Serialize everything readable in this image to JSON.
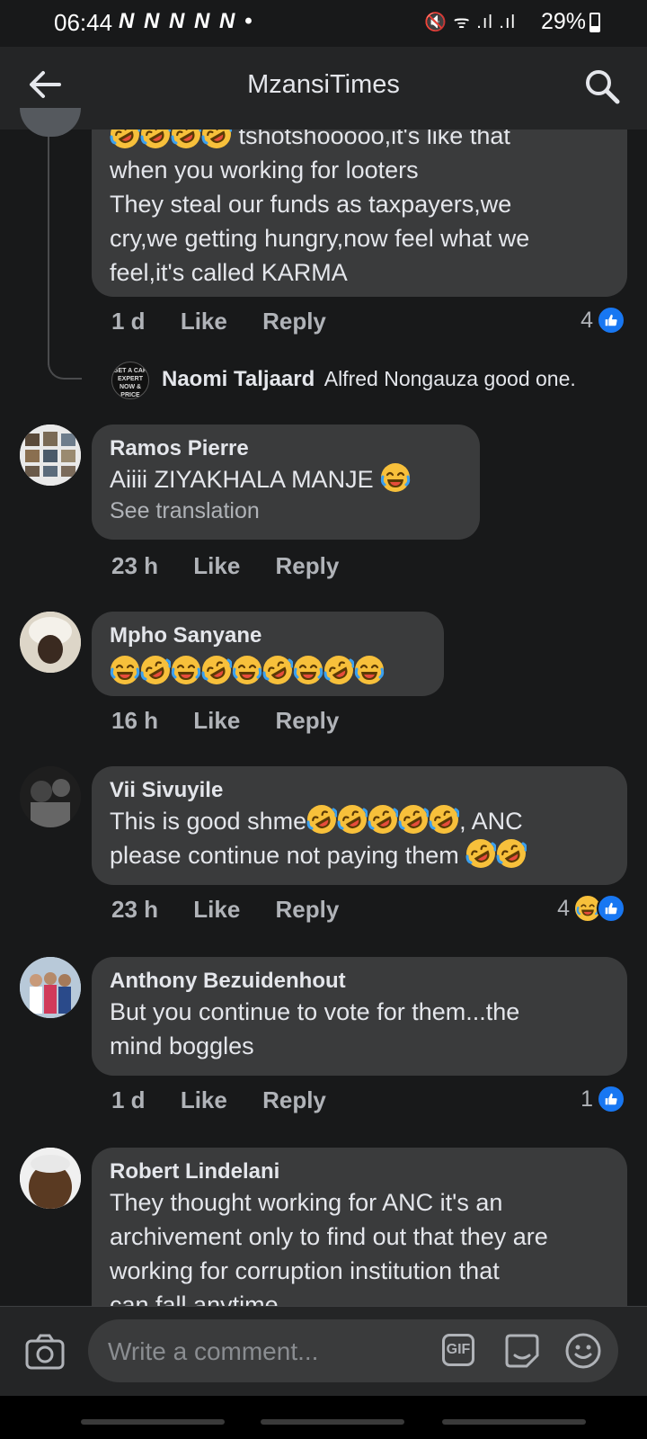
{
  "status_bar": {
    "time": "06:44",
    "notifications": "N N N N N •",
    "signal_icons": "🔇 ᯤ .ıl .ıl",
    "battery": "29%"
  },
  "header": {
    "title": "MzansiTimes"
  },
  "comments": [
    {
      "partial_text": "🤣🤣🤣🤣 tshotshooooo,it's like that when you working for looters They steal our funds as taxpayers,we cry,we getting hungry,now feel what we feel,it's called KARMA",
      "line1": "tshotshooooo,it's like that",
      "line2": "when you working for looters",
      "line3": "They steal our funds as taxpayers,we",
      "line4": "cry,we getting hungry,now feel what we",
      "line5": "feel,it's called KARMA",
      "time": "1 d",
      "like": "Like",
      "reply": "Reply",
      "reaction_count": "4"
    },
    {
      "reply_author": "Naomi Taljaard",
      "reply_text": "Alfred Nongauza good one."
    },
    {
      "author": "Ramos Pierre",
      "text": "Aiiii  ZIYAKHALA MANJE",
      "translation": "See translation",
      "time": "23 h",
      "like": "Like",
      "reply": "Reply"
    },
    {
      "author": "Mpho Sanyane",
      "text": "😂🤣😂🤣😂🤣😂🤣😂",
      "time": "16 h",
      "like": "Like",
      "reply": "Reply"
    },
    {
      "author": "Vii Sivuyile",
      "line1": "This is good shme",
      "line1_end": ", ANC",
      "line2": "please continue not paying them",
      "time": "23 h",
      "like": "Like",
      "reply": "Reply",
      "reaction_count": "4"
    },
    {
      "author": "Anthony Bezuidenhout",
      "line1": "But you continue to vote for them...the",
      "line2": "mind boggles",
      "time": "1 d",
      "like": "Like",
      "reply": "Reply",
      "reaction_count": "1"
    },
    {
      "author": "Robert Lindelani",
      "line1": "They thought working for ANC it's an",
      "line2": "archivement only to find out that they are",
      "line3": "working for corruption institution that",
      "line4": "can fall anytime."
    }
  ],
  "composer": {
    "placeholder": "Write a comment...",
    "gif_label": "GIF"
  },
  "colors": {
    "background": "#18191a",
    "bubble": "#3a3b3c",
    "like_blue": "#1877f2",
    "muted": "#b0b3b8"
  },
  "icons": [
    "back-arrow-icon",
    "search-icon",
    "like-icon",
    "haha-icon",
    "camera-icon",
    "gif-icon",
    "sticker-icon",
    "emoji-icon"
  ]
}
